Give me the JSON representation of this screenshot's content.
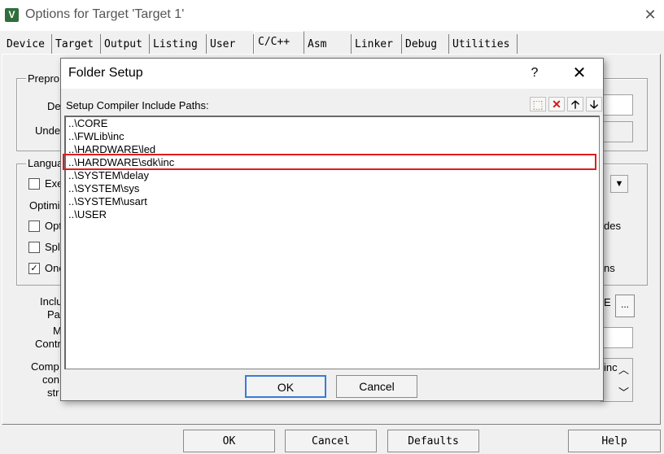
{
  "window": {
    "title": "Options for Target 'Target 1'",
    "close_glyph": "✕",
    "app_icon_letter": "V"
  },
  "tabs": [
    "Device",
    "Target",
    "Output",
    "Listing",
    "User",
    "C/C++",
    "Asm",
    "Linker",
    "Debug",
    "Utilities"
  ],
  "active_tab": "C/C++",
  "background_fragments": {
    "preprocessor_group": "Prepro",
    "define_label": "De",
    "undefine_label": "Unde",
    "language_group": "Langua",
    "execute_only": "Exe",
    "optimization_label": "Optimi",
    "optimize_time": "Opt",
    "split_sections": "Spl",
    "one_elf": "One",
    "checkbox_check": "✓",
    "include_paths_label_1": "Inclu",
    "include_paths_label_2": "Pa",
    "misc_controls_label_1": "M",
    "misc_controls_label_2": "Contr",
    "compiler_control_label_1": "Comp",
    "compiler_control_label_2": "con",
    "compiler_control_label_3": "str",
    "right_fragment_des": "des",
    "right_fragment_ns": "ns",
    "right_fragment_inc": "inc",
    "right_fragment_e": "E",
    "browse_label": "...",
    "dropdown_arrow": "▼",
    "scroll_up": "︿",
    "scroll_down": "﹀"
  },
  "bottom_buttons": {
    "ok": "OK",
    "cancel": "Cancel",
    "defaults": "Defaults",
    "help": "Help"
  },
  "dialog": {
    "title": "Folder Setup",
    "help_glyph": "?",
    "close_glyph": "✕",
    "header_label": "Setup Compiler Include Paths:",
    "toolbar_icons": [
      "new-folder-icon",
      "delete-icon",
      "move-up-icon",
      "move-down-icon"
    ],
    "toolbar_glyphs": [
      "⬚",
      "✕",
      "🡡",
      "🡣"
    ],
    "paths": [
      "..\\CORE",
      "..\\FWLib\\inc",
      "..\\HARDWARE\\led",
      "..\\HARDWARE\\sdk\\inc",
      "..\\SYSTEM\\delay",
      "..\\SYSTEM\\sys",
      "..\\SYSTEM\\usart",
      "..\\USER"
    ],
    "highlighted_index": 3,
    "highlight_color": "#e01c1c",
    "ok_label": "OK",
    "cancel_label": "Cancel"
  }
}
